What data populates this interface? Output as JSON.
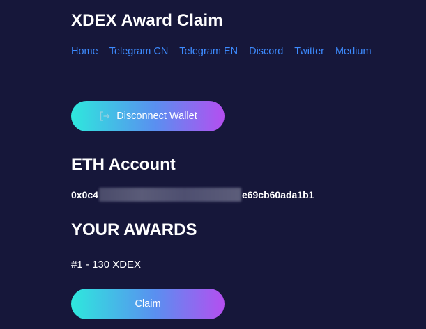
{
  "page": {
    "title": "XDEX Award Claim"
  },
  "nav": {
    "links": [
      "Home",
      "Telegram CN",
      "Telegram EN",
      "Discord",
      "Twitter",
      "Medium"
    ]
  },
  "wallet": {
    "disconnect_label": "Disconnect Wallet",
    "icon": "logout-icon"
  },
  "account": {
    "heading": "ETH Account",
    "address_prefix": "0x0c4",
    "address_suffix": "e69cb60ada1b1"
  },
  "awards": {
    "heading": "YOUR AWARDS",
    "items": [
      "#1 - 130 XDEX"
    ],
    "claim_label": "Claim"
  },
  "colors": {
    "background": "#16173a",
    "link": "#3d8bff",
    "gradient_start": "#2ee8dd",
    "gradient_end": "#b44ff0"
  }
}
